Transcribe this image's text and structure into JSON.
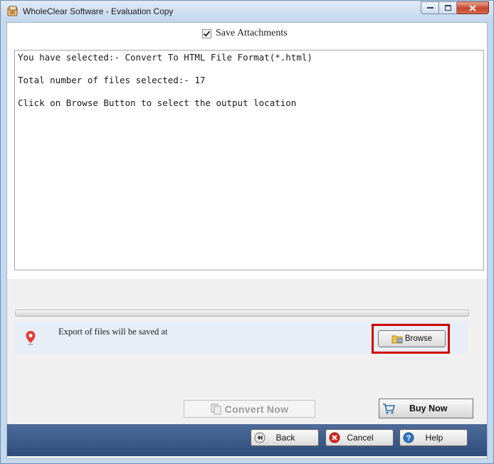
{
  "window": {
    "title": "WholeClear Software - Evaluation Copy"
  },
  "options": {
    "save_attachments_label": "Save Attachments",
    "save_attachments_checked": true
  },
  "log": {
    "lines": [
      "You have selected:- Convert To HTML File Format(*.html)",
      "Total number of files selected:- 17",
      "Click on Browse Button to select the output location"
    ]
  },
  "progress": {
    "value": 0
  },
  "export": {
    "label": "Export of files will be saved at",
    "browse_label": "Browse"
  },
  "actions": {
    "convert_label": "Convert Now",
    "buy_label": "Buy Now"
  },
  "footer": {
    "back_label": "Back",
    "cancel_label": "Cancel",
    "help_label": "Help"
  },
  "colors": {
    "highlight": "#d00000",
    "footer_bg": "#3b5a8a"
  }
}
